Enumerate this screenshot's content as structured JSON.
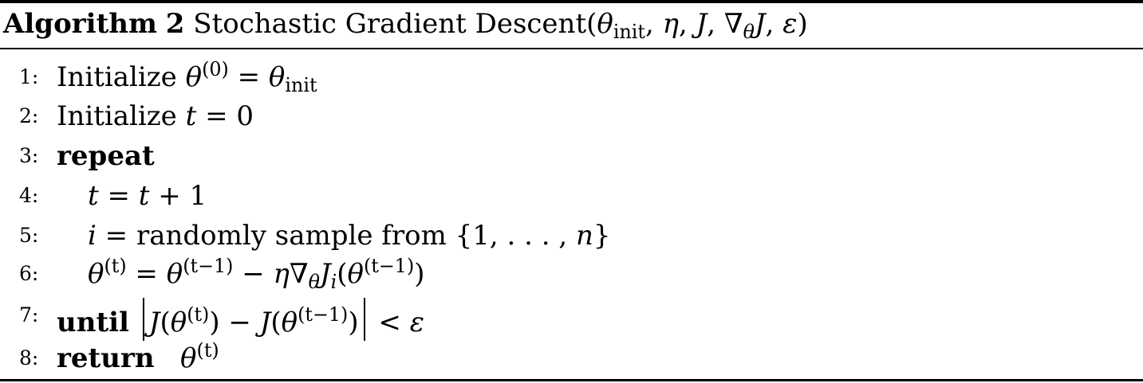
{
  "caption": {
    "label": "Algorithm",
    "number": "2",
    "title": "Stochastic Gradient Descent",
    "args": {
      "theta": "θ",
      "init": "init",
      "sep": ", ",
      "eta": "η",
      "J": "J",
      "nabla": "∇",
      "theta_sub": "θ",
      "eps": "ε",
      "open": "(",
      "close": ")"
    }
  },
  "lines": [
    {
      "num": "1:",
      "word": "Initialize",
      "theta": "θ",
      "sup": "(0)",
      "eq": " = ",
      "theta2": "θ",
      "sub": "init"
    },
    {
      "num": "2:",
      "word": "Initialize",
      "t": "t",
      "eq": " = 0"
    },
    {
      "num": "3:",
      "keyword": "repeat"
    },
    {
      "num": "4:",
      "t": "t",
      "eq": " = ",
      "t2": "t",
      "plus": " + 1"
    },
    {
      "num": "5:",
      "i": "i",
      "eq": " = ",
      "text": "randomly sample from {1, . . . , ",
      "n": "n",
      "close": "}"
    },
    {
      "num": "6:",
      "theta": "θ",
      "sup": "(t)",
      "eq": " = ",
      "theta2": "θ",
      "sup2": "(t−1)",
      "minus": " − ",
      "eta": "η",
      "nabla": "∇",
      "sub": "θ",
      "J": "J",
      "subi": "i",
      "open": "(",
      "theta3": "θ",
      "sup3": "(t−1)",
      "close": ")"
    },
    {
      "num": "7:",
      "keyword": "until",
      "J": "J",
      "open": "(",
      "theta": "θ",
      "sup": "(t)",
      "close": ")",
      "minus": " − ",
      "J2": "J",
      "theta2": "θ",
      "sup2": "(t−1)",
      "lt": " < ",
      "eps": "ε"
    },
    {
      "num": "8:",
      "keyword": "return",
      "theta": "θ",
      "sup": "(t)"
    }
  ]
}
